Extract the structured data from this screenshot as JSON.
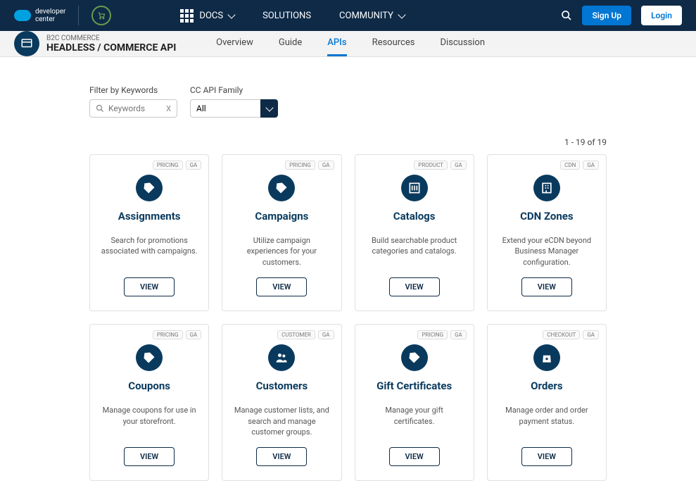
{
  "header": {
    "logo_top": "developer",
    "logo_bottom": "center",
    "nav": {
      "docs": "DOCS",
      "solutions": "SOLUTIONS",
      "community": "COMMUNITY"
    },
    "signup": "Sign Up",
    "login": "Login"
  },
  "subheader": {
    "category": "B2C COMMERCE",
    "title": "HEADLESS / COMMERCE API",
    "tabs": {
      "overview": "Overview",
      "guide": "Guide",
      "apis": "APIs",
      "resources": "Resources",
      "discussion": "Discussion"
    }
  },
  "filters": {
    "keywords_label": "Filter by Keywords",
    "keywords_placeholder": "Keywords",
    "clear": "X",
    "family_label": "CC API Family",
    "family_value": "All"
  },
  "results": {
    "count_text": "1 - 19 of 19"
  },
  "cards": [
    {
      "badges": [
        "PRICING",
        "GA"
      ],
      "icon": "tag",
      "title": "Assignments",
      "desc": "Search for promotions associated with campaigns.",
      "btn": "VIEW"
    },
    {
      "badges": [
        "PRICING",
        "GA"
      ],
      "icon": "tag",
      "title": "Campaigns",
      "desc": "Utilize campaign experiences for your customers.",
      "btn": "VIEW"
    },
    {
      "badges": [
        "PRODUCT",
        "GA"
      ],
      "icon": "catalog",
      "title": "Catalogs",
      "desc": "Build searchable product categories and catalogs.",
      "btn": "VIEW"
    },
    {
      "badges": [
        "CDN",
        "GA"
      ],
      "icon": "building",
      "title": "CDN Zones",
      "desc": "Extend your eCDN beyond Business Manager configuration.",
      "btn": "VIEW"
    },
    {
      "badges": [
        "PRICING",
        "GA"
      ],
      "icon": "tag",
      "title": "Coupons",
      "desc": "Manage coupons for use in your storefront.",
      "btn": "VIEW"
    },
    {
      "badges": [
        "CUSTOMER",
        "GA"
      ],
      "icon": "people",
      "title": "Customers",
      "desc": "Manage customer lists, and search and manage customer groups.",
      "btn": "VIEW"
    },
    {
      "badges": [
        "PRICING",
        "GA"
      ],
      "icon": "tag",
      "title": "Gift Certificates",
      "desc": "Manage your gift certificates.",
      "btn": "VIEW"
    },
    {
      "badges": [
        "CHECKOUT",
        "GA"
      ],
      "icon": "bag",
      "title": "Orders",
      "desc": "Manage order and order payment status.",
      "btn": "VIEW"
    }
  ]
}
